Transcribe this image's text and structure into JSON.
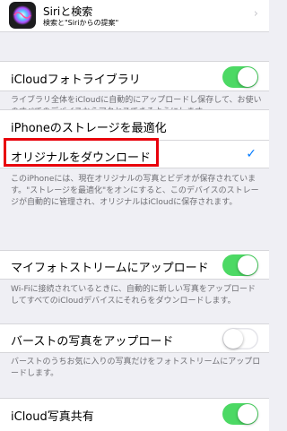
{
  "siri": {
    "title": "Siriと検索",
    "subtitle": "検索と\"Siriからの提案\""
  },
  "icloud_photo_library": {
    "label": "iCloudフォトライブラリ",
    "enabled": true,
    "footer": "ライブラリ全体をiCloudに自動的にアップロードし保存して、お使いのすべてのデバイスからアクセスできるようにします。"
  },
  "storage": {
    "optimize_label": "iPhoneのストレージを最適化",
    "download_label": "オリジナルをダウンロード",
    "selected": "download",
    "footer": "このiPhoneには、現在オリジナルの写真とビデオが保存されています。\"ストレージを最適化\"をオンにすると、このデバイスのストレージが自動的に管理され、オリジナルはiCloudに保存されます。"
  },
  "my_photo_stream": {
    "label": "マイフォトストリームにアップロード",
    "enabled": true,
    "footer": "Wi-Fiに接続されているときに、自動的に新しい写真をアップロードしてすべてのiCloudデバイスにそれらをダウンロードします。"
  },
  "burst_photos": {
    "label": "バーストの写真をアップロード",
    "enabled": false,
    "footer": "バーストのうちお気に入りの写真だけをフォトストリームにアップロードします。"
  },
  "icloud_photo_sharing": {
    "label": "iCloud写真共有",
    "enabled": true
  },
  "colors": {
    "toggle_on": "#4cd964",
    "checkmark": "#007aff",
    "highlight": "#e8000b"
  }
}
